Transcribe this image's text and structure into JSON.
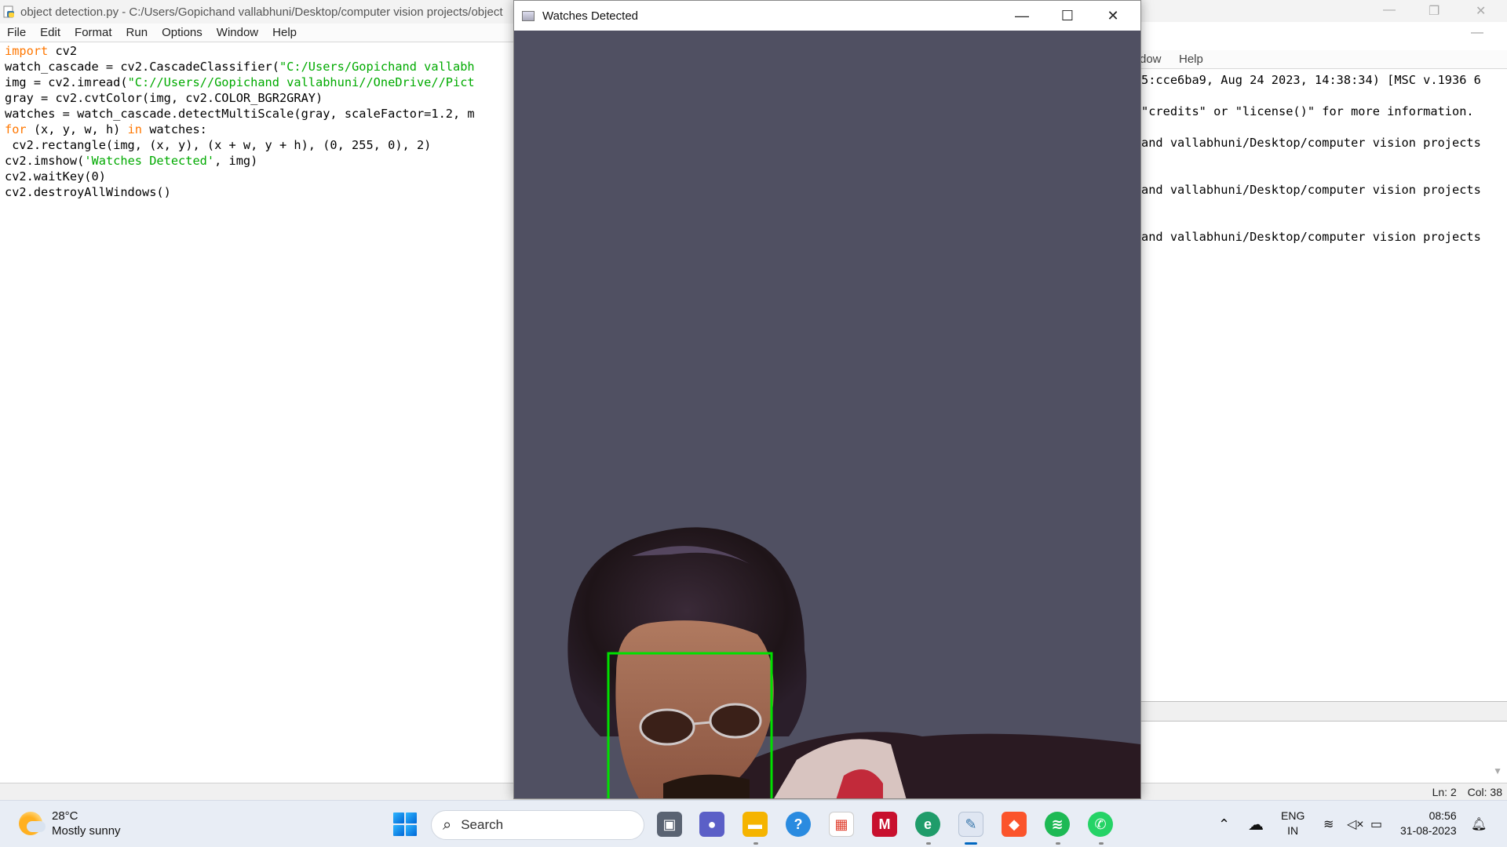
{
  "editor": {
    "title": "object detection.py - C:/Users/Gopichand vallabhuni/Desktop/computer vision projects/object",
    "menu": [
      "File",
      "Edit",
      "Format",
      "Run",
      "Options",
      "Window",
      "Help"
    ],
    "code": {
      "l1_kw": "import",
      "l1_rest": " cv2",
      "l2_pre": "watch_cascade = cv2.CascadeClassifier(",
      "l2_str": "\"C:/Users/Gopichand vallabh",
      "l3_pre": "img = cv2.imread(",
      "l3_str": "\"C://Users//Gopichand vallabhuni//OneDrive//Pict",
      "l4": "gray = cv2.cvtColor(img, cv2.COLOR_BGR2GRAY)",
      "l5": "watches = watch_cascade.detectMultiScale(gray, scaleFactor=1.2, m",
      "l6_kw1": "for",
      "l6_mid": " (x, y, w, h) ",
      "l6_kw2": "in",
      "l6_rest": " watches:",
      "l7": " cv2.rectangle(img, (x, y), (x + w, y + h), (0, 255, 0), 2)",
      "l8_pre": "cv2.imshow(",
      "l8_str": "'Watches Detected'",
      "l8_rest": ", img)",
      "l9": "cv2.waitKey(0)",
      "l10": "cv2.destroyAllWindows()"
    }
  },
  "shell": {
    "menu": [
      "dow",
      "Help"
    ],
    "output": [
      "5:cce6ba9, Aug 24 2023, 14:38:34) [MSC v.1936 6",
      "\"credits\" or \"license()\" for more information.",
      "and vallabhuni/Desktop/computer vision projects",
      "and vallabhuni/Desktop/computer vision projects",
      "and vallabhuni/Desktop/computer vision projects"
    ],
    "controls": {
      "minimize": "—",
      "restore": "❐",
      "close": "✕",
      "sub_minimize": "—"
    }
  },
  "statusbar": {
    "line": "Ln: 2",
    "col": "Col: 38"
  },
  "viewer": {
    "title": "Watches Detected",
    "controls": {
      "minimize": "—",
      "maximize": "☐",
      "close": "✕"
    },
    "detection_box_color": "#00e000",
    "background_color": "#505062"
  },
  "taskbar": {
    "weather": {
      "temp": "28°C",
      "desc": "Mostly sunny"
    },
    "search_placeholder": "Search",
    "tray": {
      "lang_top": "ENG",
      "lang_bottom": "IN",
      "time": "08:56",
      "date": "31-08-2023"
    },
    "apps": [
      "task-view",
      "meet",
      "file-explorer",
      "help",
      "microsoft-store",
      "mcafee",
      "edge",
      "python-idle",
      "brave",
      "spotify",
      "whatsapp"
    ]
  }
}
